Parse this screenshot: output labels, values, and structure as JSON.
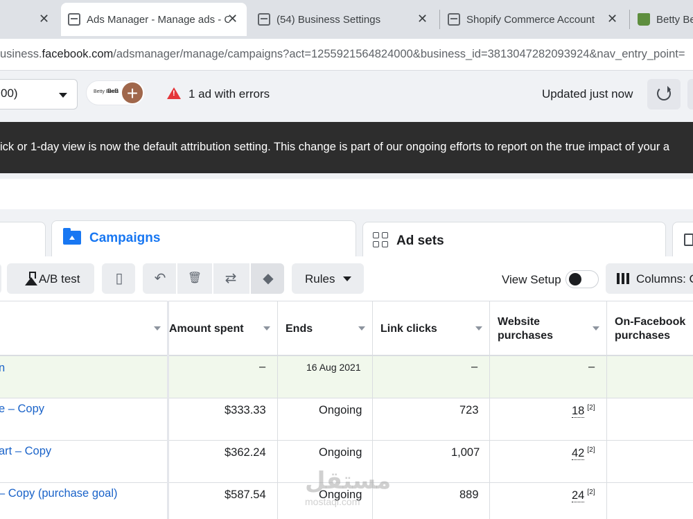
{
  "browser": {
    "tabs": [
      {
        "title": "",
        "active": false
      },
      {
        "title": "Ads Manager - Manage ads - Campaigns",
        "active": true
      },
      {
        "title": "(54) Business Settings",
        "active": false
      },
      {
        "title": "Shopify Commerce Account",
        "active": false
      },
      {
        "title": "Betty Bern",
        "active": false
      }
    ],
    "close_glyph": "✕",
    "url_prefix": "usiness.",
    "url_domain": "facebook.com",
    "url_rest": "/adsmanager/manage/campaigns?act=1255921564824000&business_id=3813047282093924&nav_entry_point="
  },
  "toolbar": {
    "account_value": "00)",
    "brand_mini": "Betty Berns",
    "brand_mini2": "BeB",
    "add_glyph": "+",
    "errors_text": "1 ad with errors",
    "updated_text": "Updated just now"
  },
  "banner": {
    "text": "ick or 1-day view is now the default attribution setting. This change is part of our ongoing efforts to report on the true impact of your a"
  },
  "levels": {
    "campaigns": "Campaigns",
    "ad_sets": "Ad sets"
  },
  "actions": {
    "ab_test": "A/B test",
    "duplicate_glyph": "▯",
    "undo_glyph": "↶",
    "delete_glyph": "🗑",
    "swap_glyph": "⇄",
    "tag_glyph": "◆",
    "rules": "Rules",
    "view_setup": "View Setup",
    "columns": "Columns: C"
  },
  "table": {
    "headers": {
      "amount_spent": "Amount spent",
      "ends": "Ends",
      "link_clicks": "Link clicks",
      "website_purchases_1": "Website",
      "website_purchases_2": "purchases",
      "onfb_purchases_1": "On-Facebook",
      "onfb_purchases_2": "purchases"
    },
    "rows": [
      {
        "name": "n",
        "amount": "–",
        "ends": "16 Aug 2021",
        "clicks": "–",
        "purchases": "–",
        "footnote": ""
      },
      {
        "name": "e – Copy",
        "amount": "$333.33",
        "ends": "Ongoing",
        "clicks": "723",
        "purchases": "18",
        "footnote": "[2]"
      },
      {
        "name": "art – Copy",
        "amount": "$362.24",
        "ends": "Ongoing",
        "clicks": "1,007",
        "purchases": "42",
        "footnote": "[2]"
      },
      {
        "name": "– Copy (purchase goal)",
        "amount": "$587.54",
        "ends": "Ongoing",
        "clicks": "889",
        "purchases": "24",
        "footnote": "[2]"
      }
    ]
  },
  "watermark": {
    "arabic": "مستقل",
    "latin": "mostaql.com"
  },
  "colors": {
    "link": "#1a63c9",
    "selected_row": "#f1f8ec",
    "banner_bg": "#2d2d2d",
    "error": "#e4363a",
    "accent": "#1877f2"
  }
}
